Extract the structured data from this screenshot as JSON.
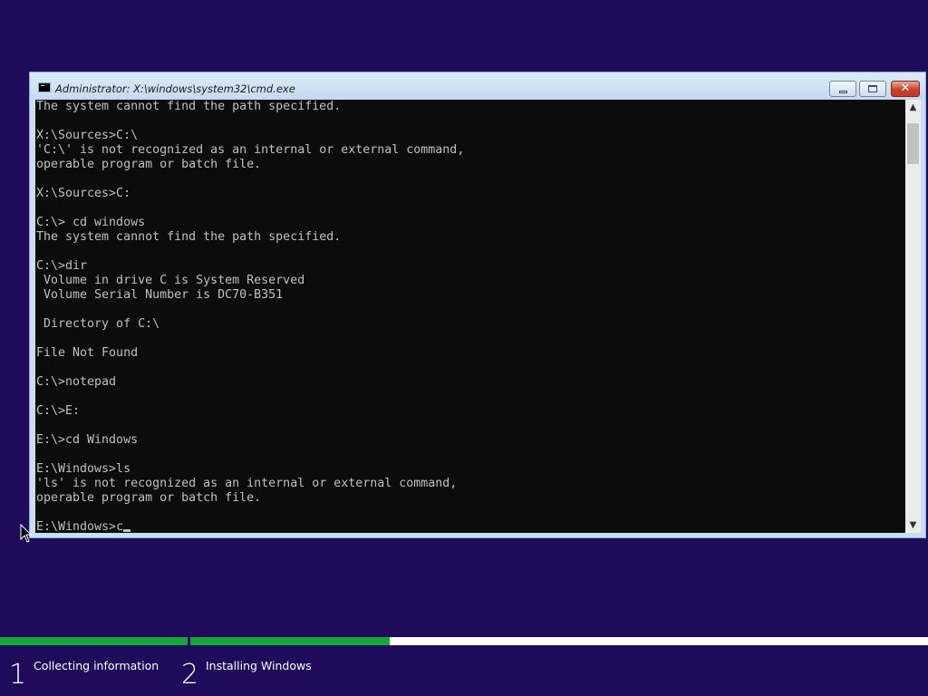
{
  "window": {
    "title": "Administrator: X:\\windows\\system32\\cmd.exe",
    "minimize_icon": "minimize-icon",
    "maximize_icon": "maximize-icon",
    "close_glyph": "✕"
  },
  "console": {
    "lines": [
      "The system cannot find the path specified.",
      "",
      "X:\\Sources>C:\\",
      "'C:\\' is not recognized as an internal or external command,",
      "operable program or batch file.",
      "",
      "X:\\Sources>C:",
      "",
      "C:\\> cd windows",
      "The system cannot find the path specified.",
      "",
      "C:\\>dir",
      " Volume in drive C is System Reserved",
      " Volume Serial Number is DC70-B351",
      "",
      " Directory of C:\\",
      "",
      "File Not Found",
      "",
      "C:\\>notepad",
      "",
      "C:\\>E:",
      "",
      "E:\\>cd Windows",
      "",
      "E:\\Windows>ls",
      "'ls' is not recognized as an internal or external command,",
      "operable program or batch file.",
      ""
    ],
    "prompt": "E:\\Windows>",
    "input": "c",
    "text_color": "#c0c0c0",
    "background": "#0c0c0c"
  },
  "scrollbar": {
    "up_glyph": "▲",
    "down_glyph": "▼"
  },
  "setup": {
    "steps": [
      {
        "number": "1",
        "label": "Collecting information",
        "progress": 1.0
      },
      {
        "number": "2",
        "label": "Installing Windows",
        "progress": 0.27
      }
    ],
    "progress_color": "#15a53a",
    "background": "#1f0a5c"
  }
}
